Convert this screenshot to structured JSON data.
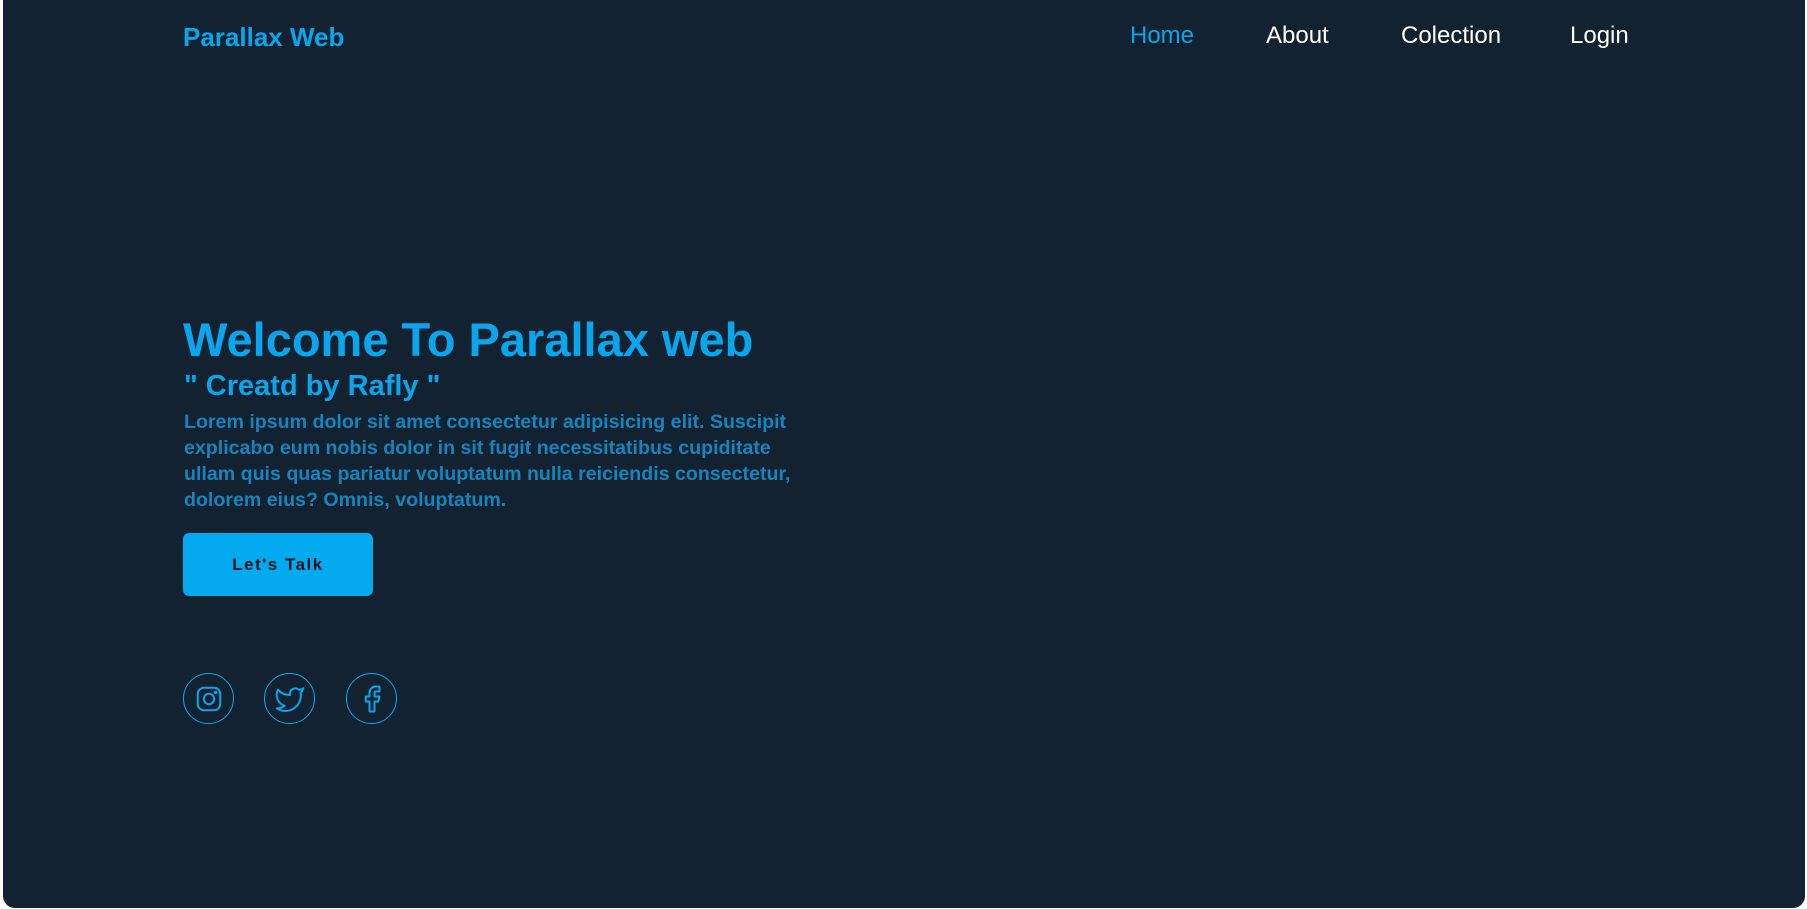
{
  "header": {
    "logo": "Parallax Web",
    "nav": [
      {
        "label": "Home",
        "active": true
      },
      {
        "label": "About",
        "active": false
      },
      {
        "label": "Colection",
        "active": false
      },
      {
        "label": "Login",
        "active": false
      }
    ]
  },
  "hero": {
    "title": "Welcome To Parallax web",
    "subtitle": "\" Creatd by Rafly \"",
    "text": "Lorem ipsum dolor sit amet consectetur adipisicing elit. Suscipit explicabo eum nobis dolor in sit fugit necessitatibus cupiditate ullam quis quas pariatur voluptatum nulla reiciendis consectetur, dolorem eius? Omnis, voluptatum.",
    "button_label": "Let's Talk"
  },
  "social": [
    {
      "icon": "instagram-icon"
    },
    {
      "icon": "twitter-icon"
    },
    {
      "icon": "facebook-icon"
    }
  ],
  "colors": {
    "background": "#132230",
    "accent": "#09a6ee",
    "body_text": "#1684bd",
    "button": "#03aaf0",
    "nav_text": "#ffffff"
  }
}
